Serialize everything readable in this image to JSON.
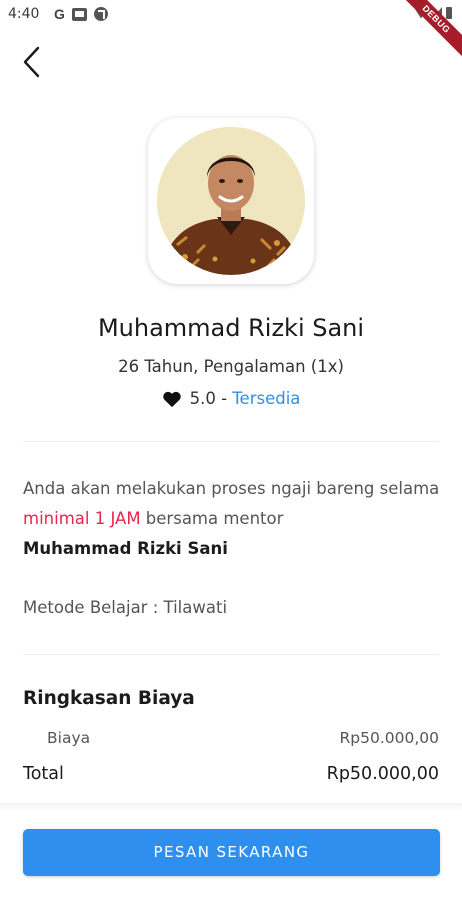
{
  "status_bar": {
    "time": "4:40",
    "icons_left": [
      "google-g-icon",
      "gallery-notification-icon",
      "app-notification-icon"
    ],
    "icons_right": [
      "wifi-icon",
      "signal-icon",
      "battery-icon"
    ]
  },
  "debug_banner": "DEBUG",
  "mentor": {
    "name": "Muhammad Rizki Sani",
    "meta": "26 Tahun, Pengalaman (1x)",
    "rating": "5.0",
    "rating_separator": " - ",
    "availability": "Tersedia"
  },
  "notice": {
    "part1": "Anda akan melakukan proses ngaji bareng selama ",
    "highlight": "minimal 1 JAM",
    "part2": " bersama mentor",
    "mentor_name": "Muhammad Rizki Sani"
  },
  "method": "Metode Belajar : Tilawati",
  "summary": {
    "title": "Ringkasan Biaya",
    "fee_label": "Biaya",
    "fee_value": "Rp50.000,00",
    "total_label": "Total",
    "total_value": "Rp50.000,00"
  },
  "actions": {
    "order_label": "PESAN SEKARANG"
  },
  "colors": {
    "accent": "#2f8fee",
    "link": "#2f8fe7",
    "highlight": "#e8264d",
    "debug": "#a61c2a"
  }
}
